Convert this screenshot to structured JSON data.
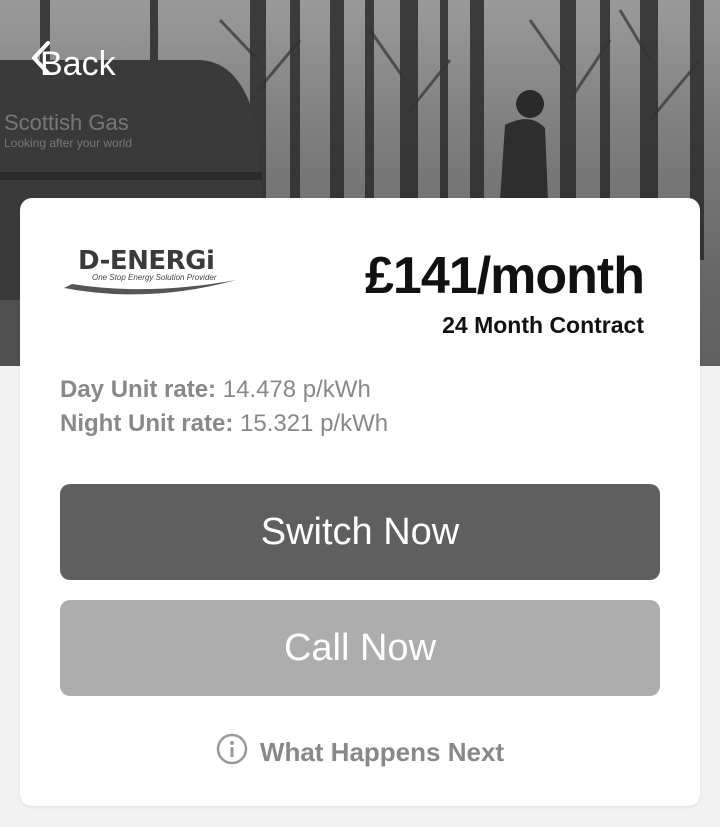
{
  "header": {
    "back_label": "Back",
    "back_icon": "chevron-left-icon"
  },
  "hero": {
    "van_brand": "Scottish Gas",
    "van_tagline": "Looking after your world"
  },
  "offer": {
    "logo_text": "D-ENERGi",
    "logo_tagline": "One Stop Energy Solution Provider",
    "price": "£141/month",
    "contract": "24 Month Contract",
    "day_rate_label": "Day Unit rate:",
    "day_rate_value": "14.478 p/kWh",
    "night_rate_label": "Night Unit rate:",
    "night_rate_value": "15.321 p/kWh"
  },
  "actions": {
    "switch_label": "Switch Now",
    "call_label": "Call Now",
    "next_label": "What Happens Next",
    "next_icon": "info-icon"
  },
  "colors": {
    "switch_button": "#5f5f5f",
    "call_button": "#adadad",
    "muted_text": "#888888"
  }
}
